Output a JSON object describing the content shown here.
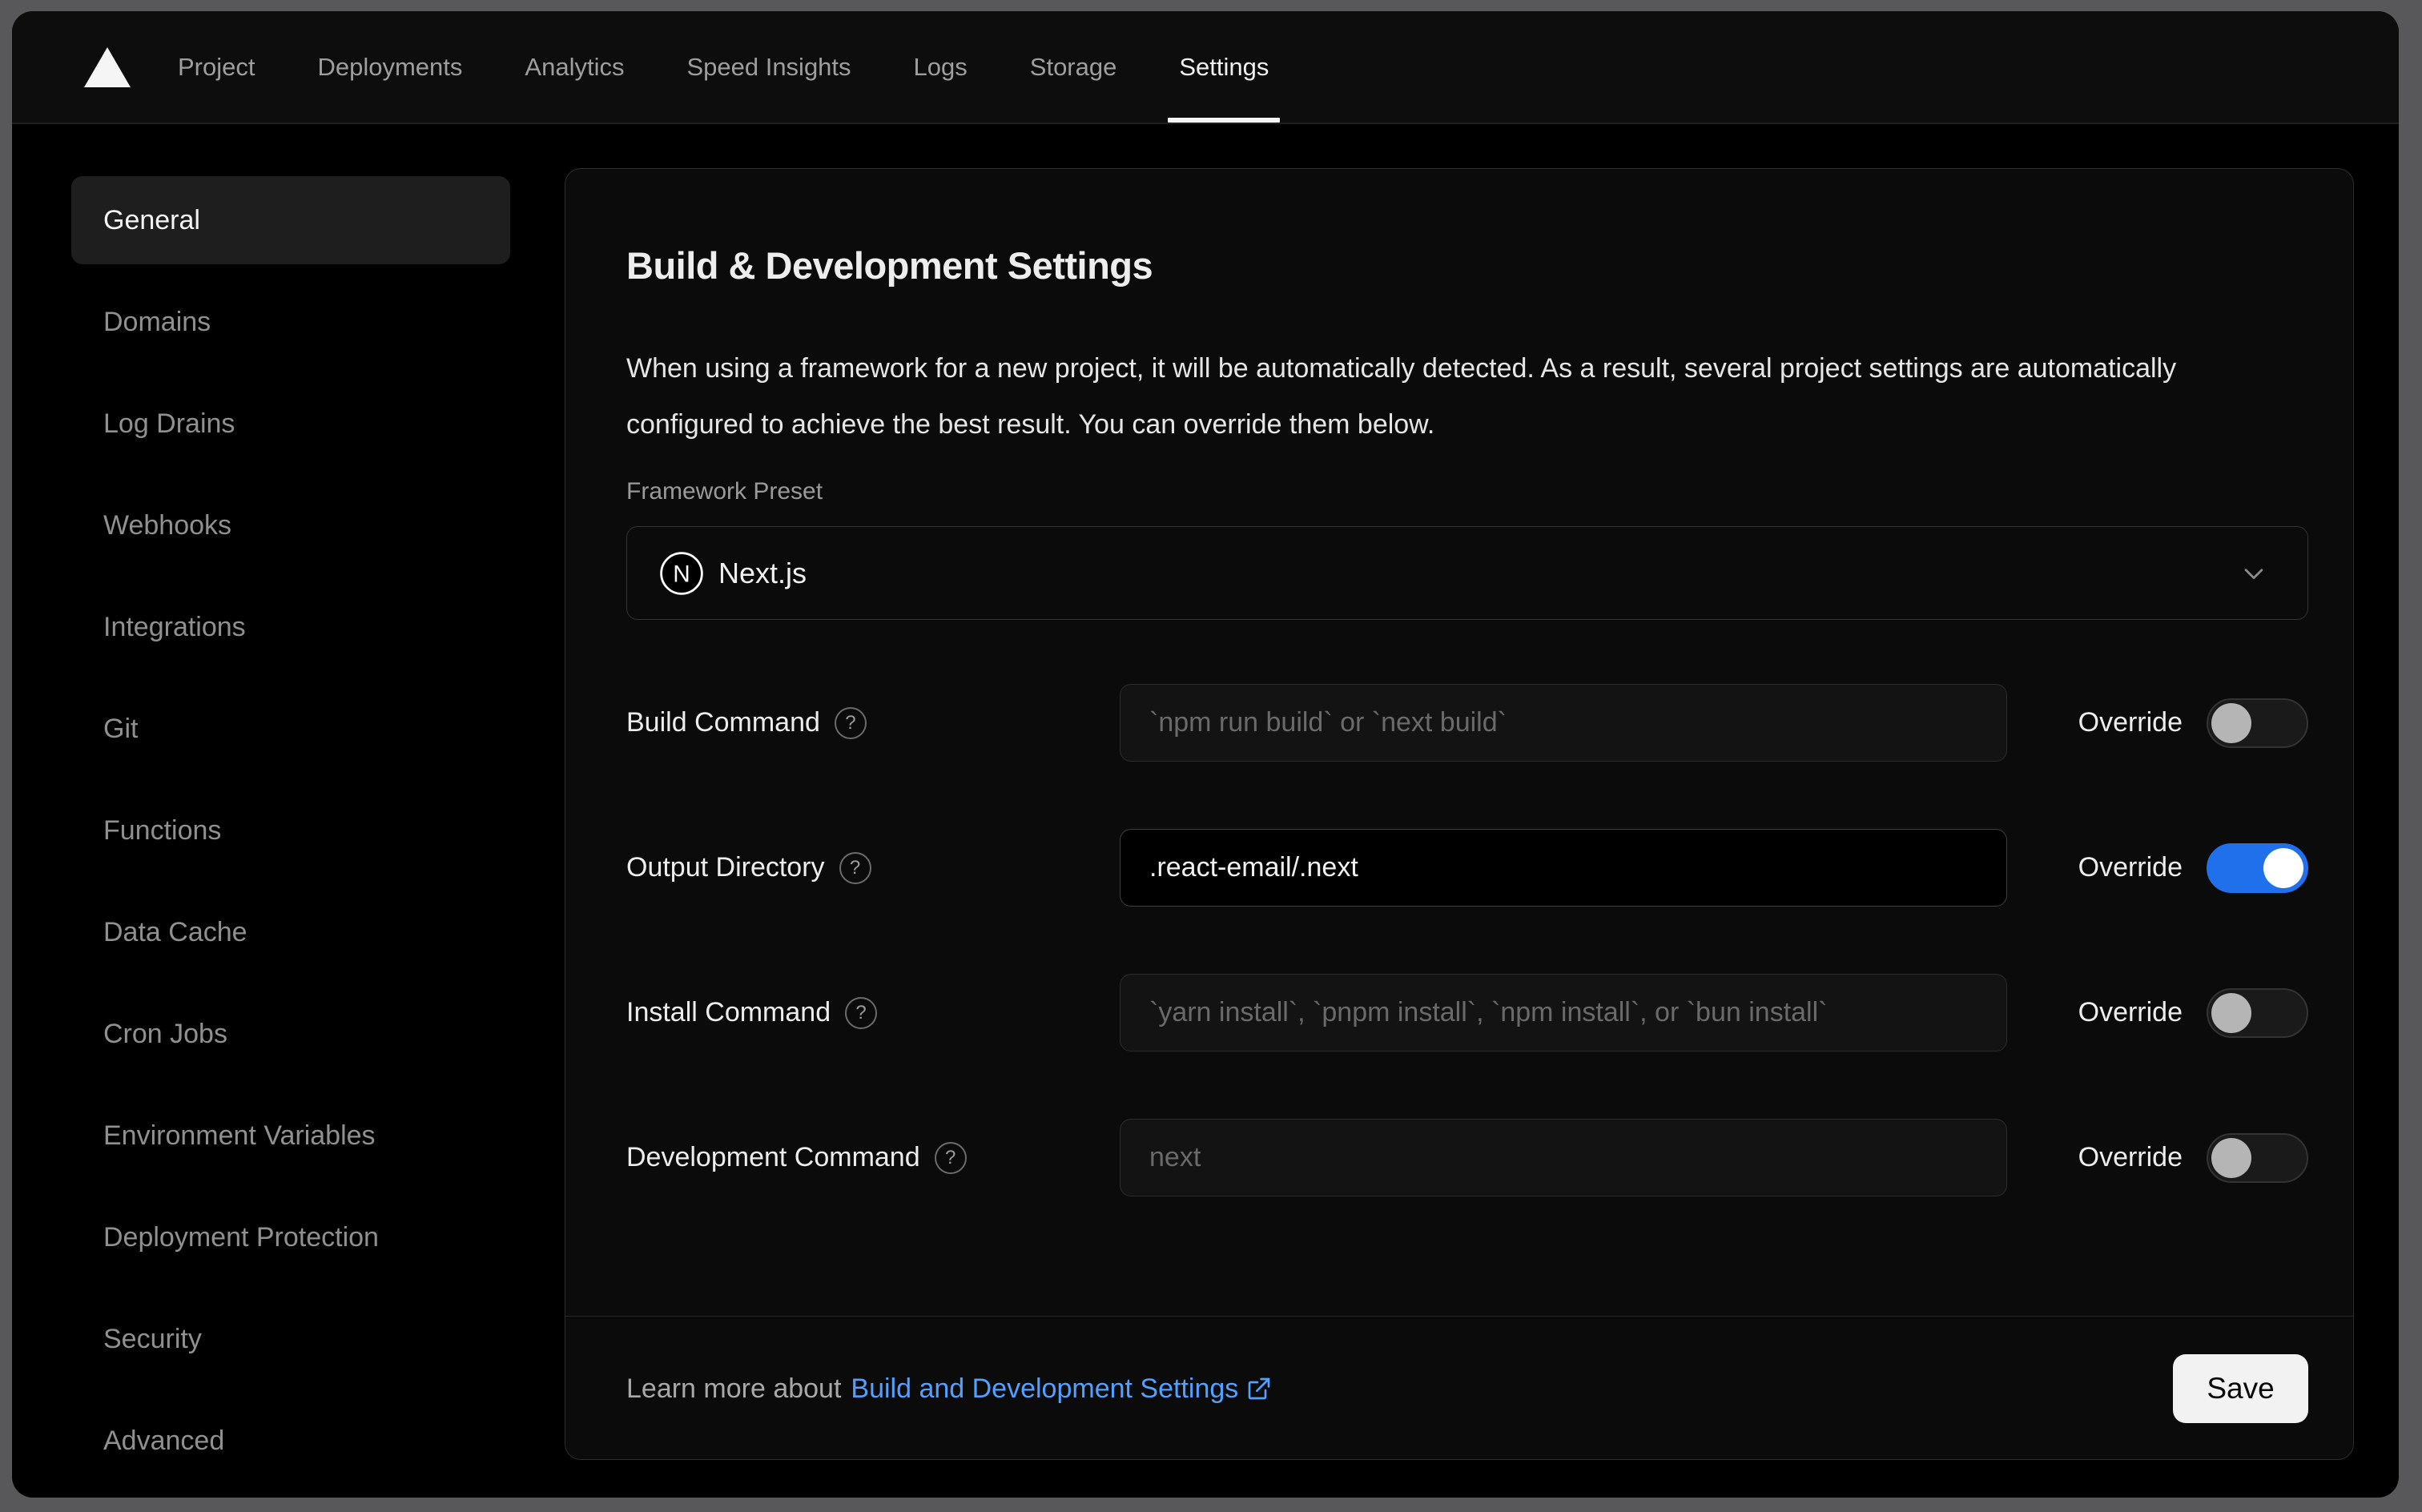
{
  "nav": {
    "tabs": [
      {
        "label": "Project",
        "active": false
      },
      {
        "label": "Deployments",
        "active": false
      },
      {
        "label": "Analytics",
        "active": false
      },
      {
        "label": "Speed Insights",
        "active": false
      },
      {
        "label": "Logs",
        "active": false
      },
      {
        "label": "Storage",
        "active": false
      },
      {
        "label": "Settings",
        "active": true
      }
    ]
  },
  "sidebar": {
    "items": [
      {
        "label": "General",
        "active": true
      },
      {
        "label": "Domains",
        "active": false
      },
      {
        "label": "Log Drains",
        "active": false
      },
      {
        "label": "Webhooks",
        "active": false
      },
      {
        "label": "Integrations",
        "active": false
      },
      {
        "label": "Git",
        "active": false
      },
      {
        "label": "Functions",
        "active": false
      },
      {
        "label": "Data Cache",
        "active": false
      },
      {
        "label": "Cron Jobs",
        "active": false
      },
      {
        "label": "Environment Variables",
        "active": false
      },
      {
        "label": "Deployment Protection",
        "active": false
      },
      {
        "label": "Security",
        "active": false
      },
      {
        "label": "Advanced",
        "active": false
      }
    ]
  },
  "main": {
    "title": "Build & Development Settings",
    "description": "When using a framework for a new project, it will be automatically detected. As a result, several project settings are automatically configured to achieve the best result. You can override them below.",
    "framework": {
      "label": "Framework Preset",
      "value": "Next.js"
    },
    "override_label": "Override",
    "rows": [
      {
        "label": "Build Command",
        "placeholder": "`npm run build` or `next build`",
        "value": "",
        "override": false
      },
      {
        "label": "Output Directory",
        "placeholder": "",
        "value": ".react-email/.next",
        "override": true
      },
      {
        "label": "Install Command",
        "placeholder": "`yarn install`, `pnpm install`, `npm install`, or `bun install`",
        "value": "",
        "override": false
      },
      {
        "label": "Development Command",
        "placeholder": "next",
        "value": "",
        "override": false
      }
    ],
    "footer": {
      "text_prefix": "Learn more about",
      "link_label": "Build and Development Settings",
      "save_label": "Save"
    }
  },
  "icons": {
    "help_glyph": "?",
    "nextjs_letter": "N"
  },
  "colors": {
    "toggle_on_blue": "#2170eb",
    "link_blue": "#52a0ff",
    "active_underline": "#f5f5f5",
    "save_button_bg": "#f2f2f2"
  }
}
